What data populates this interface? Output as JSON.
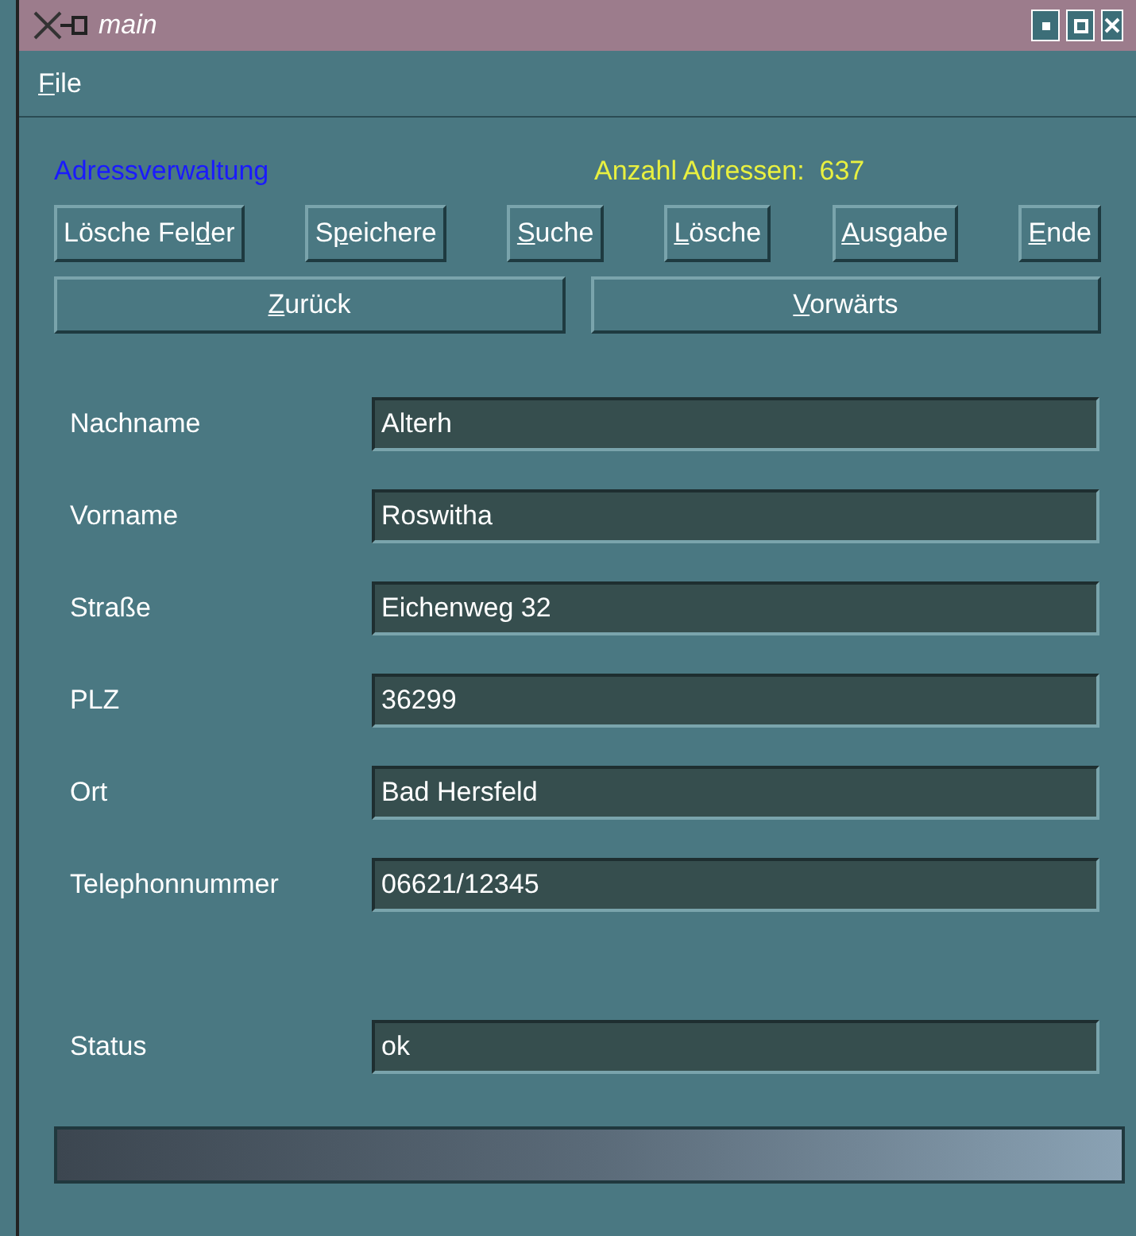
{
  "window": {
    "title": "main"
  },
  "menu": [
    {
      "access_key": "F",
      "text_after": "ile"
    }
  ],
  "header": {
    "title": "Adressverwaltung",
    "count_label": "Anzahl Adressen:",
    "count": "637"
  },
  "buttons": [
    {
      "text_before": "Lösche Fel",
      "access_key": "d",
      "text_after": "er"
    },
    {
      "text_before": "S",
      "access_key": "p",
      "text_after": "eichere"
    },
    {
      "access_key": "S",
      "text_after": "uche"
    },
    {
      "access_key": "L",
      "text_after": "ösche"
    },
    {
      "access_key": "A",
      "text_after": "usgabe"
    },
    {
      "access_key": "E",
      "text_after": "nde"
    }
  ],
  "nav_buttons": [
    {
      "access_key": "Z",
      "text_after": "urück"
    },
    {
      "access_key": "V",
      "text_after": "orwärts"
    }
  ],
  "fields": [
    {
      "label": "Nachname",
      "value": "Alterh"
    },
    {
      "label": "Vorname",
      "value": "Roswitha"
    },
    {
      "label": "Straße",
      "value": "Eichenweg 32"
    },
    {
      "label": "PLZ",
      "value": "36299"
    },
    {
      "label": "Ort",
      "value": "Bad Hersfeld"
    },
    {
      "label": "Telephonnummer",
      "value": "06621/12345"
    }
  ],
  "status": {
    "label": "Status",
    "value": "ok"
  },
  "progress": {
    "level": 1
  }
}
